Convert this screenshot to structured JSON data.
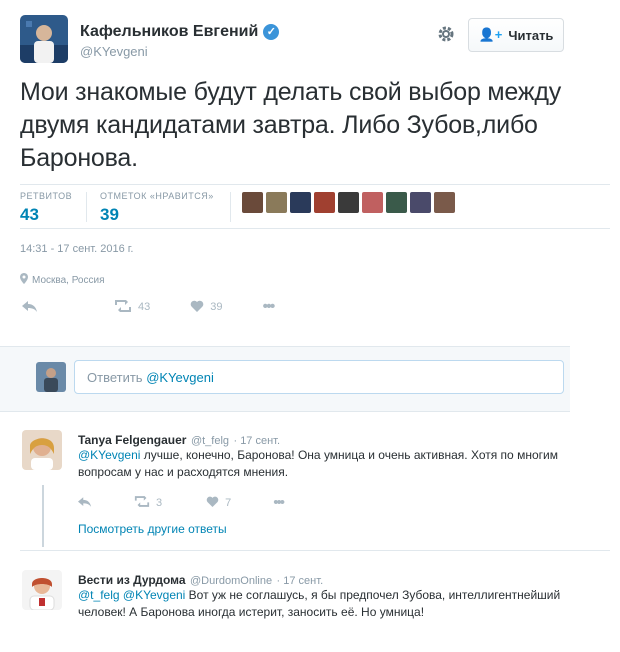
{
  "tweet": {
    "author_name": "Кафельников Евгений",
    "author_handle": "@KYevgeni",
    "follow_label": "Читать",
    "text": "Мои знакомые будут делать свой выбор между двумя кандидатами завтра. Либо Зубов,либо Баронова.",
    "retweets_label": "РЕТВИТОВ",
    "retweets_count": "43",
    "likes_label": "ОТМЕТОК «НРАВИТСЯ»",
    "likes_count": "39",
    "timestamp": "14:31 - 17 сент. 2016 г.",
    "location": "Москва, Россия",
    "action_retweet_count": "43",
    "action_like_count": "39",
    "liker_colors": [
      "#6a4a3a",
      "#8a7a5a",
      "#2a3a5a",
      "#a04030",
      "#3a3a3a",
      "#c06060",
      "#3a5a4a",
      "#4a4a6a",
      "#7a5a4a"
    ]
  },
  "reply_box": {
    "prefix": "Ответить ",
    "mention": "@KYevgeni"
  },
  "replies": [
    {
      "name": "Tanya Felgengauer",
      "handle": "@t_felg",
      "date": "· 17 сент.",
      "mention": "@KYevgeni",
      "text": " лучше, конечно, Баронова! Она умница и очень активная. Хотя по многим вопросам у нас и расходятся мнения.",
      "retweets": "3",
      "likes": "7",
      "more_label": "Посмотреть другие ответы"
    },
    {
      "name": "Вести из Дурдома",
      "handle": "@DurdomOnline",
      "date": "· 17 сент.",
      "mention1": "@t_felg",
      "mention2": "@KYevgeni",
      "text": " Вот уж не соглашусь, я бы предпочел Зубова, интеллигентнейший человек! А Баронова иногда истерит, заносить её. Но умница!"
    }
  ],
  "colors": {
    "link": "#0084b4",
    "muted": "#8899a6",
    "verified": "#3b94d9"
  }
}
